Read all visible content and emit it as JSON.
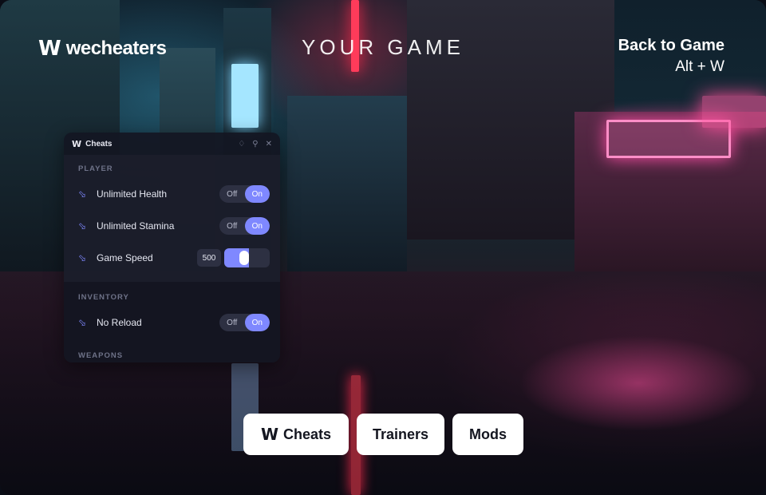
{
  "brand": {
    "logo_glyph": "W",
    "name": "wecheaters"
  },
  "game_title": "YOUR GAME",
  "back_to_game": {
    "label": "Back to Game",
    "hotkey": "Alt + W"
  },
  "panel": {
    "logo_glyph": "W",
    "title": "Cheats",
    "window_buttons": [
      "bell-icon",
      "pin-icon",
      "close-icon"
    ],
    "sections": [
      {
        "label": "PLAYER"
      },
      {
        "label": "INVENTORY"
      },
      {
        "label": "WEAPONS"
      }
    ],
    "cheats": {
      "unlimited_health": {
        "label": "Unlimited Health",
        "off": "Off",
        "on": "On",
        "state": "on"
      },
      "unlimited_stamina": {
        "label": "Unlimited Stamina",
        "off": "Off",
        "on": "On",
        "state": "on"
      },
      "game_speed": {
        "label": "Game Speed",
        "value": "500",
        "fill_fraction": 0.55
      },
      "no_reload": {
        "label": "No Reload",
        "off": "Off",
        "on": "On",
        "state": "on"
      }
    }
  },
  "tabs": [
    {
      "label": "Cheats",
      "icon": "W"
    },
    {
      "label": "Trainers"
    },
    {
      "label": "Mods"
    }
  ],
  "colors": {
    "accent": "#7f88ff",
    "panel_bg": "#141622",
    "tab_bg": "#ffffff"
  }
}
